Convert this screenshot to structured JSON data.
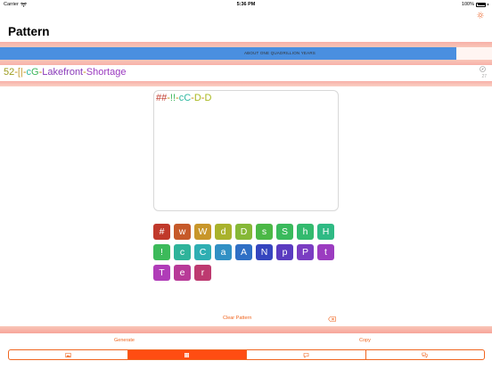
{
  "status_bar": {
    "carrier": "Carrier",
    "time": "5:36 PM",
    "battery": "100%"
  },
  "header": {
    "title": "Pattern"
  },
  "strength": {
    "label": "ABOUT ONE QUADRILLION YEARS",
    "fill_fraction": 0.93
  },
  "password": {
    "segments": [
      {
        "text": "52",
        "color": "#9a9a1a"
      },
      {
        "text": "-",
        "color": "#c08a00"
      },
      {
        "text": "[|",
        "color": "#c5a03a"
      },
      {
        "text": "-",
        "color": "#c08a00"
      },
      {
        "text": "c",
        "color": "#2fb8a0"
      },
      {
        "text": "G",
        "color": "#3cb55a"
      },
      {
        "text": "-",
        "color": "#c08a00"
      },
      {
        "text": "Lakefront",
        "color": "#8a3ab9"
      },
      {
        "text": "-",
        "color": "#c08a00"
      },
      {
        "text": "Shortage",
        "color": "#9b3ac0"
      }
    ],
    "length": "27"
  },
  "pattern": {
    "segments": [
      {
        "text": "##",
        "color": "#c0392b"
      },
      {
        "text": "-",
        "color": "#c08a00"
      },
      {
        "text": "!!",
        "color": "#3cb55a"
      },
      {
        "text": "-",
        "color": "#c08a00"
      },
      {
        "text": "cC",
        "color": "#2fb8a0"
      },
      {
        "text": "-",
        "color": "#c08a00"
      },
      {
        "text": "D",
        "color": "#a8b81e"
      },
      {
        "text": "-",
        "color": "#c08a00"
      },
      {
        "text": "D",
        "color": "#a8b81e"
      }
    ]
  },
  "keyboard": {
    "rows": [
      [
        {
          "label": "#",
          "color": "#c0392b"
        },
        {
          "label": "w",
          "color": "#c65a2a"
        },
        {
          "label": "W",
          "color": "#c8962a"
        },
        {
          "label": "d",
          "color": "#a9b22c"
        },
        {
          "label": "D",
          "color": "#86b837"
        },
        {
          "label": "s",
          "color": "#4bb846"
        },
        {
          "label": "S",
          "color": "#3aba5c"
        },
        {
          "label": "h",
          "color": "#33ba6e"
        },
        {
          "label": "H",
          "color": "#2fba84"
        }
      ],
      [
        {
          "label": "!",
          "color": "#3cba5a"
        },
        {
          "label": "c",
          "color": "#2fb39a"
        },
        {
          "label": "C",
          "color": "#2eaeb2"
        },
        {
          "label": "a",
          "color": "#3190c4"
        },
        {
          "label": "A",
          "color": "#2f6fc5"
        },
        {
          "label": "N",
          "color": "#3545bf"
        },
        {
          "label": "p",
          "color": "#5a3bc0"
        },
        {
          "label": "P",
          "color": "#7a3dc2"
        },
        {
          "label": "t",
          "color": "#9b3cc0"
        }
      ],
      [
        {
          "label": "T",
          "color": "#b03cb8"
        },
        {
          "label": "e",
          "color": "#b83a98"
        },
        {
          "label": "r",
          "color": "#bd3a70"
        }
      ]
    ]
  },
  "actions": {
    "clear_label": "Clear Pattern",
    "generate_label": "Generate",
    "copy_label": "Copy"
  },
  "tabs": [
    {
      "icon": "image-icon",
      "active": false
    },
    {
      "icon": "pattern-grid-icon",
      "active": true
    },
    {
      "icon": "speech-bubble-icon",
      "active": false
    },
    {
      "icon": "chat-bubbles-icon",
      "active": false
    }
  ],
  "colors": {
    "accent": "#f0651f",
    "active_tab": "#ff4d12",
    "strength_bar": "#4a8fe0",
    "band": "#f7b0a8"
  }
}
